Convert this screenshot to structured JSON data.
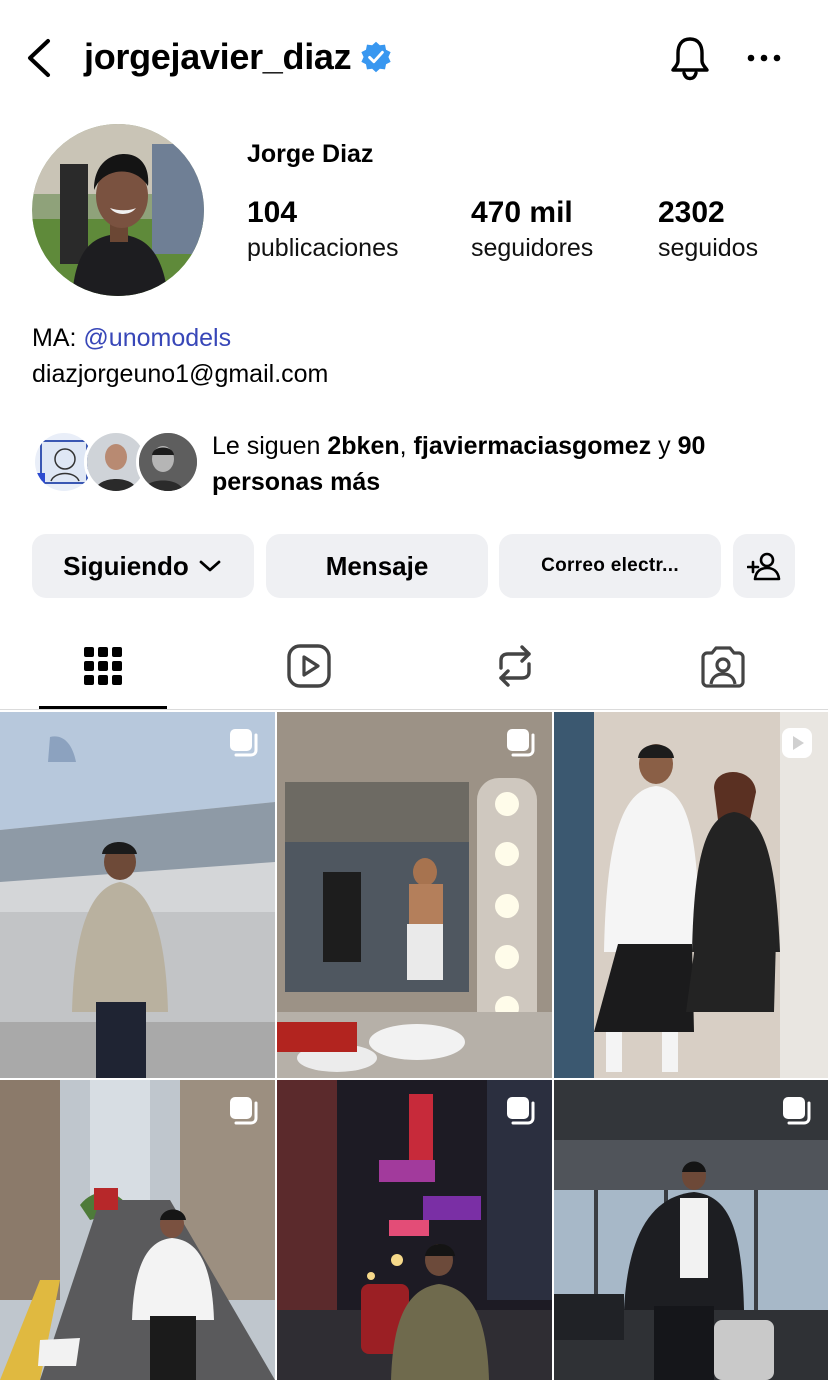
{
  "header": {
    "username": "jorgejavier_diaz",
    "back_icon": "chevron-left-icon",
    "verified_icon": "verified-badge-icon",
    "bell_icon": "bell-icon",
    "more_icon": "more-horizontal-icon"
  },
  "profile": {
    "full_name": "Jorge Diaz",
    "stats": {
      "posts_count": "104",
      "posts_label": "publicaciones",
      "followers_count": "470 mil",
      "followers_label": "seguidores",
      "following_count": "2302",
      "following_label": "seguidos"
    },
    "bio": {
      "line1_prefix": "MA: ",
      "line1_mention": "@unomodels",
      "line2": "diazjorgeuno1@gmail.com"
    },
    "followed_by": {
      "prefix": "Le siguen ",
      "user1": "2bken",
      "separator": ", ",
      "user2": "fjaviermaciasgomez",
      "conjunction": " y ",
      "more": "90 personas más"
    }
  },
  "actions": {
    "following_label": "Siguiendo",
    "message_label": "Mensaje",
    "email_label": "Correo electr...",
    "add_user_icon": "add-user-icon"
  },
  "tabs": [
    {
      "name": "posts-grid",
      "icon": "grid-icon",
      "active": true
    },
    {
      "name": "reels",
      "icon": "reels-icon",
      "active": false
    },
    {
      "name": "reposts",
      "icon": "repost-icon",
      "active": false
    },
    {
      "name": "tagged",
      "icon": "tagged-icon",
      "active": false
    }
  ],
  "grid_posts": [
    {
      "type": "carousel",
      "badge_icon": "carousel-icon"
    },
    {
      "type": "carousel",
      "badge_icon": "carousel-icon"
    },
    {
      "type": "reel",
      "badge_icon": "play-icon"
    },
    {
      "type": "carousel",
      "badge_icon": "carousel-icon"
    },
    {
      "type": "carousel",
      "badge_icon": "carousel-icon"
    },
    {
      "type": "carousel",
      "badge_icon": "carousel-icon"
    }
  ],
  "colors": {
    "mention": "#3847b8",
    "verified": "#3897f0",
    "button_bg": "#eff0f3"
  }
}
